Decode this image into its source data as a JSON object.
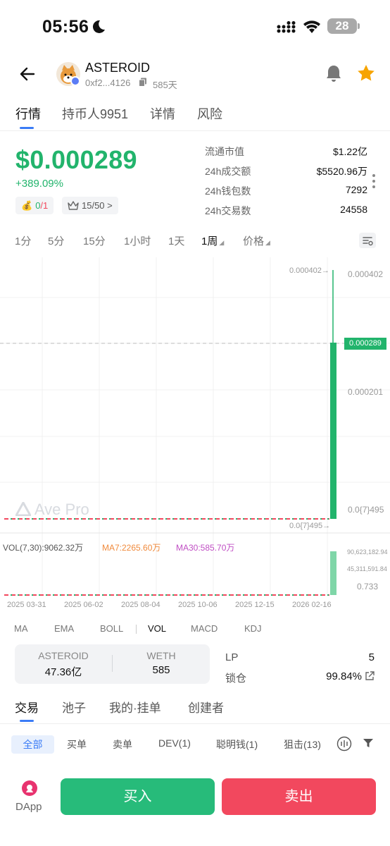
{
  "status_bar": {
    "time": "05:56",
    "battery": "28"
  },
  "header": {
    "token_name": "ASTEROID",
    "address": "0xf2...4126",
    "age": "585天"
  },
  "tabs": [
    {
      "label": "行情",
      "active": true
    },
    {
      "label": "持币人9951",
      "active": false
    },
    {
      "label": "详情",
      "active": false
    },
    {
      "label": "风险",
      "active": false
    }
  ],
  "price": {
    "value": "$0.000289",
    "change": "+389.09%",
    "rating_a": "0",
    "rating_b": "/1",
    "crown": "15/50 >"
  },
  "stats": [
    {
      "label": "流通市值",
      "value": "$1.22亿"
    },
    {
      "label": "24h成交额",
      "value": "$5520.96万"
    },
    {
      "label": "24h钱包数",
      "value": "7292"
    },
    {
      "label": "24h交易数",
      "value": "24558"
    }
  ],
  "intervals": [
    "1分",
    "5分",
    "15分",
    "1小时",
    "1天",
    "1周",
    "价格"
  ],
  "active_interval": "1周",
  "chart": {
    "price_axis": [
      "0.000402",
      "0.000201",
      "0.0{7}495"
    ],
    "current_price": "0.000289",
    "high_marker": "0.000402→",
    "low_marker": "0.0{7}495→",
    "watermark": "Ave Pro",
    "vol_legend": {
      "vol": "VOL(7,30):9062.32万",
      "ma7": "MA7:2265.60万",
      "ma30": "MA30:585.70万"
    },
    "vol_axis": [
      "90,623,182.94",
      "45,311,591.84",
      "0.733"
    ],
    "x_axis": [
      "2025 03-31",
      "2025 06-02",
      "2025 08-04",
      "2025 10-06",
      "2025 12-15",
      "2026 02-16"
    ],
    "colors": {
      "up": "#22b46c",
      "down": "#f2485e",
      "ma7": "#f08a3c",
      "ma30": "#c04fc4"
    }
  },
  "indicators": [
    "MA",
    "EMA",
    "BOLL",
    "VOL",
    "MACD",
    "KDJ"
  ],
  "active_indicator": "VOL",
  "pool": {
    "base_name": "ASTEROID",
    "base_value": "47.36亿",
    "quote_name": "WETH",
    "quote_value": "585",
    "lp_label": "LP",
    "lp_value": "5",
    "lock_label": "锁仓",
    "lock_value": "99.84%"
  },
  "bottom_tabs": [
    "交易",
    "池子",
    "我的·挂单",
    "创建者"
  ],
  "filters": [
    "全部",
    "买单",
    "卖单",
    "DEV(1)",
    "聪明钱(1)",
    "狙击(13)"
  ],
  "footer": {
    "dapp": "DApp",
    "buy": "买入",
    "sell": "卖出"
  }
}
